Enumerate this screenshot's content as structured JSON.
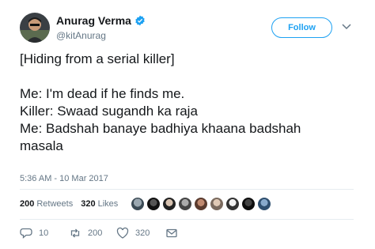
{
  "tweet": {
    "author_name": "Anurag Verma",
    "author_handle": "@kitAnurag",
    "follow_label": "Follow",
    "lines": [
      "[Hiding from a serial killer]",
      "",
      "Me: I'm dead if he finds me.",
      "Killer: Swaad sugandh ka raja",
      "Me: Badshah banaye badhiya khaana badshah",
      "masala"
    ],
    "timestamp": "5:36 AM - 10 Mar 2017",
    "retweets_count": "200",
    "retweets_label": "Retweets",
    "likes_count": "320",
    "likes_label": "Likes",
    "reply_count": "10",
    "retweet_count": "200",
    "like_count": "320"
  },
  "colors": {
    "accent": "#1da1f2",
    "text": "#14171a",
    "secondary": "#657786"
  },
  "icons": {
    "verified": "verified-badge-icon",
    "chevron": "chevron-down-icon",
    "reply": "reply-icon",
    "retweet": "retweet-icon",
    "like": "heart-icon",
    "message": "direct-message-icon"
  }
}
